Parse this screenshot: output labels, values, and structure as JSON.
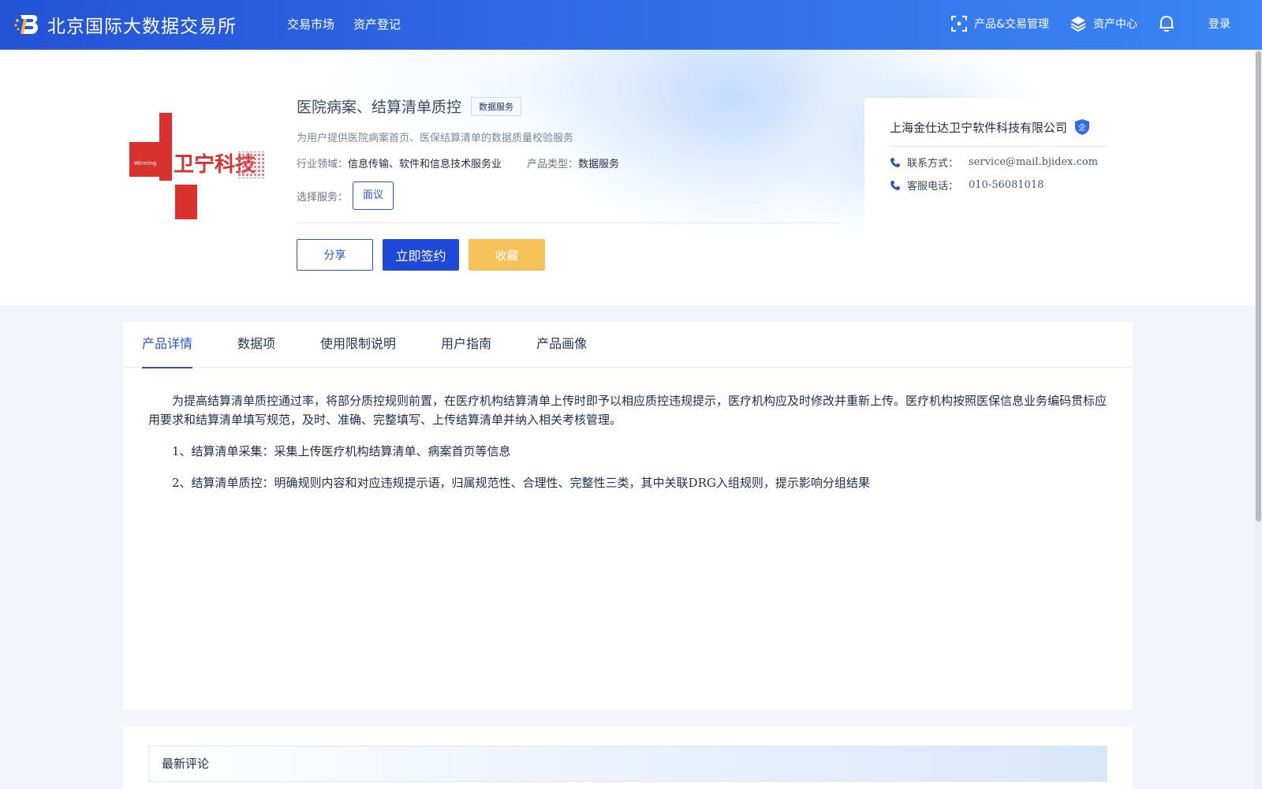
{
  "header": {
    "brand_name": "北京国际大数据交易所",
    "nav_links": [
      "交易市场",
      "资产登记"
    ],
    "product_trade_mgmt": "产品&交易管理",
    "asset_center": "资产中心",
    "login": "登录"
  },
  "product": {
    "title": "医院病案、结算清单质控",
    "tag": "数据服务",
    "description": "为用户提供医院病案首页、医保结算清单的数据质量校验服务",
    "industry_label": "行业领域：",
    "industry_value": "信息传输、软件和信息技术服务业",
    "type_label": "产品类型：",
    "type_value": "数据服务",
    "service_label": "选择服务：",
    "service_option": "面议",
    "logo_text": "卫宁科技",
    "logo_small_text": "Winning"
  },
  "actions": {
    "share": "分享",
    "sign": "立即签约",
    "favorite": "收藏"
  },
  "company": {
    "name": "上海金仕达卫宁软件科技有限公司",
    "badge": "企",
    "contact_label": "联系方式：",
    "contact_value": "service@mail.bjidex.com",
    "phone_label": "客服电话：",
    "phone_value": "010-56081018"
  },
  "tabs": [
    "产品详情",
    "数据项",
    "使用限制说明",
    "用户指南",
    "产品画像"
  ],
  "active_tab": "产品详情",
  "detail": {
    "paragraph": "为提高结算清单质控通过率，将部分质控规则前置，在医疗机构结算清单上传时即予以相应质控违规提示，医疗机构应及时修改并重新上传。医疗机构按照医保信息业务编码贯标应用要求和结算清单填写规范，及时、准确、完整填写、上传结算清单并纳入相关考核管理。",
    "item1": "1、结算清单采集：采集上传医疗机构结算清单、病案首页等信息",
    "item2": "2、结算清单质控：明确规则内容和对应违规提示语，归属规范性、合理性、完整性三类，其中关联DRG入组规则，提示影响分组结果"
  },
  "comments": {
    "title": "最新评论"
  },
  "colors": {
    "primary": "#2b52d5",
    "favorite": "#f7c25a",
    "nav_gradient_start": "#2453d6",
    "nav_gradient_end": "#3b86f5"
  }
}
